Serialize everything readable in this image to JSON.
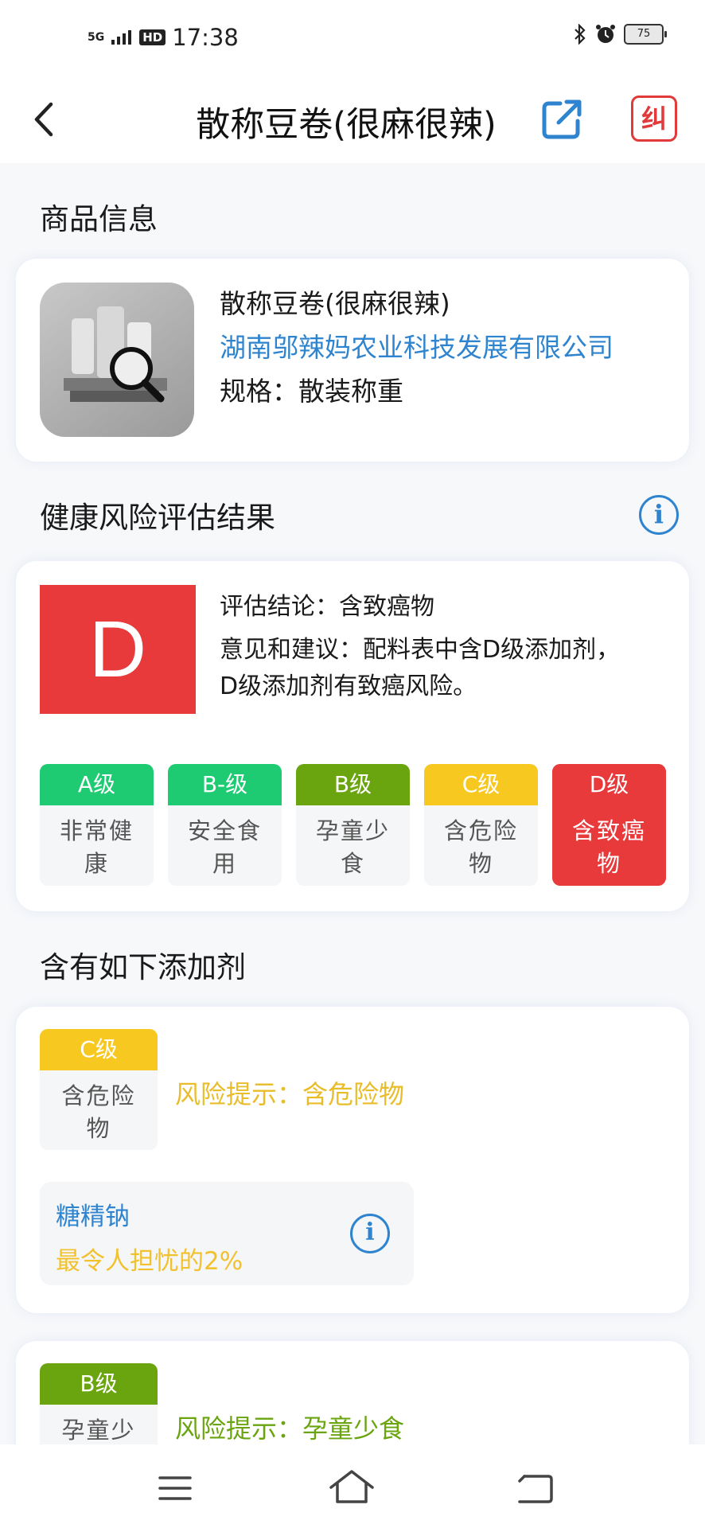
{
  "status_bar": {
    "signal": "5G",
    "hd": "HD",
    "time": "17:38",
    "battery": "75"
  },
  "nav": {
    "title": "散称豆卷(很麻很辣)",
    "correct_label": "纠"
  },
  "product_section": {
    "title": "商品信息",
    "name": "散称豆卷(很麻很辣)",
    "company": "湖南邬辣妈农业科技发展有限公司",
    "spec": "规格：散装称重"
  },
  "health_section": {
    "title": "健康风险评估结果",
    "grade": "D",
    "conclusion": "评估结论：含致癌物",
    "advice_line1": "意见和建议：配料表中含D级添加剂，",
    "advice_line2": "D级添加剂有致癌风险。"
  },
  "grade_scale": [
    {
      "grade": "A级",
      "desc": "非常健康",
      "color": "#1ecb72",
      "active": false
    },
    {
      "grade": "B-级",
      "desc": "安全食用",
      "color": "#1ecb72",
      "active": false
    },
    {
      "grade": "B级",
      "desc": "孕童少食",
      "color": "#6aa510",
      "active": false
    },
    {
      "grade": "C级",
      "desc": "含危险物",
      "color": "#f7c820",
      "active": false
    },
    {
      "grade": "D级",
      "desc": "含致癌物",
      "color": "#e8393b",
      "active": true
    }
  ],
  "additives_section": {
    "title": "含有如下添加剂",
    "groups": [
      {
        "grade": "C级",
        "desc": "含危险物",
        "risk": "风险提示：含危险物",
        "color": "#f7c820",
        "risk_color": "#e9bd2a",
        "additive_name": "糖精钠",
        "additive_pct": "最令人担忧的2%"
      },
      {
        "grade": "B级",
        "desc": "孕童少",
        "risk": "风险提示：孕童少食",
        "color": "#6aa510",
        "risk_color": "#6aa510"
      }
    ]
  },
  "icons": {
    "back": "chevron-left-icon",
    "share": "share-icon",
    "correct": "correct-icon",
    "info": "info-icon",
    "bluetooth": "bluetooth-icon",
    "alarm": "alarm-icon",
    "menu": "menu-icon",
    "home": "home-icon",
    "return": "return-icon"
  }
}
